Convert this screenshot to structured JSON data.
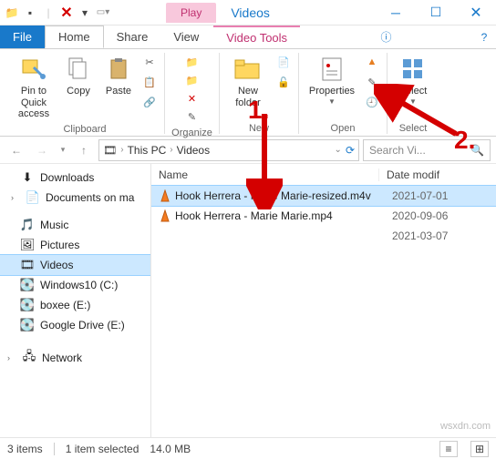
{
  "window": {
    "context_tab": "Play",
    "context_group": "Video Tools",
    "title_app": "Videos"
  },
  "menu": {
    "file": "File",
    "home": "Home",
    "share": "Share",
    "view": "View"
  },
  "ribbon": {
    "pin": "Pin to Quick access",
    "copy": "Copy",
    "paste": "Paste",
    "clipboard_group": "Clipboard",
    "organize_group": "Organize",
    "new_folder": "New folder",
    "new_group": "New",
    "properties": "Properties",
    "open_group": "Open",
    "select": "Select",
    "select_group": "Select"
  },
  "breadcrumb": {
    "root": "This PC",
    "folder": "Videos"
  },
  "search": {
    "placeholder": "Search Vi..."
  },
  "nav": {
    "downloads": "Downloads",
    "documents": "Documents on ma",
    "music": "Music",
    "pictures": "Pictures",
    "videos": "Videos",
    "windows10": "Windows10 (C:)",
    "boxee": "boxee (E:)",
    "googledrive": "Google Drive (E:)",
    "network": "Network"
  },
  "columns": {
    "name": "Name",
    "date": "Date modif"
  },
  "files": [
    {
      "name": "Hook Herrera - Marie Marie-resized.m4v",
      "date": "2021-07-01"
    },
    {
      "name": "Hook Herrera - Marie Marie.mp4",
      "date": "2020-09-06"
    },
    {
      "name": "",
      "date": "2021-03-07"
    }
  ],
  "status": {
    "count": "3 items",
    "selection": "1 item selected",
    "size": "14.0 MB"
  },
  "annotations": {
    "step1": "1.",
    "step2": "2."
  },
  "watermark": "wsxdn.com"
}
